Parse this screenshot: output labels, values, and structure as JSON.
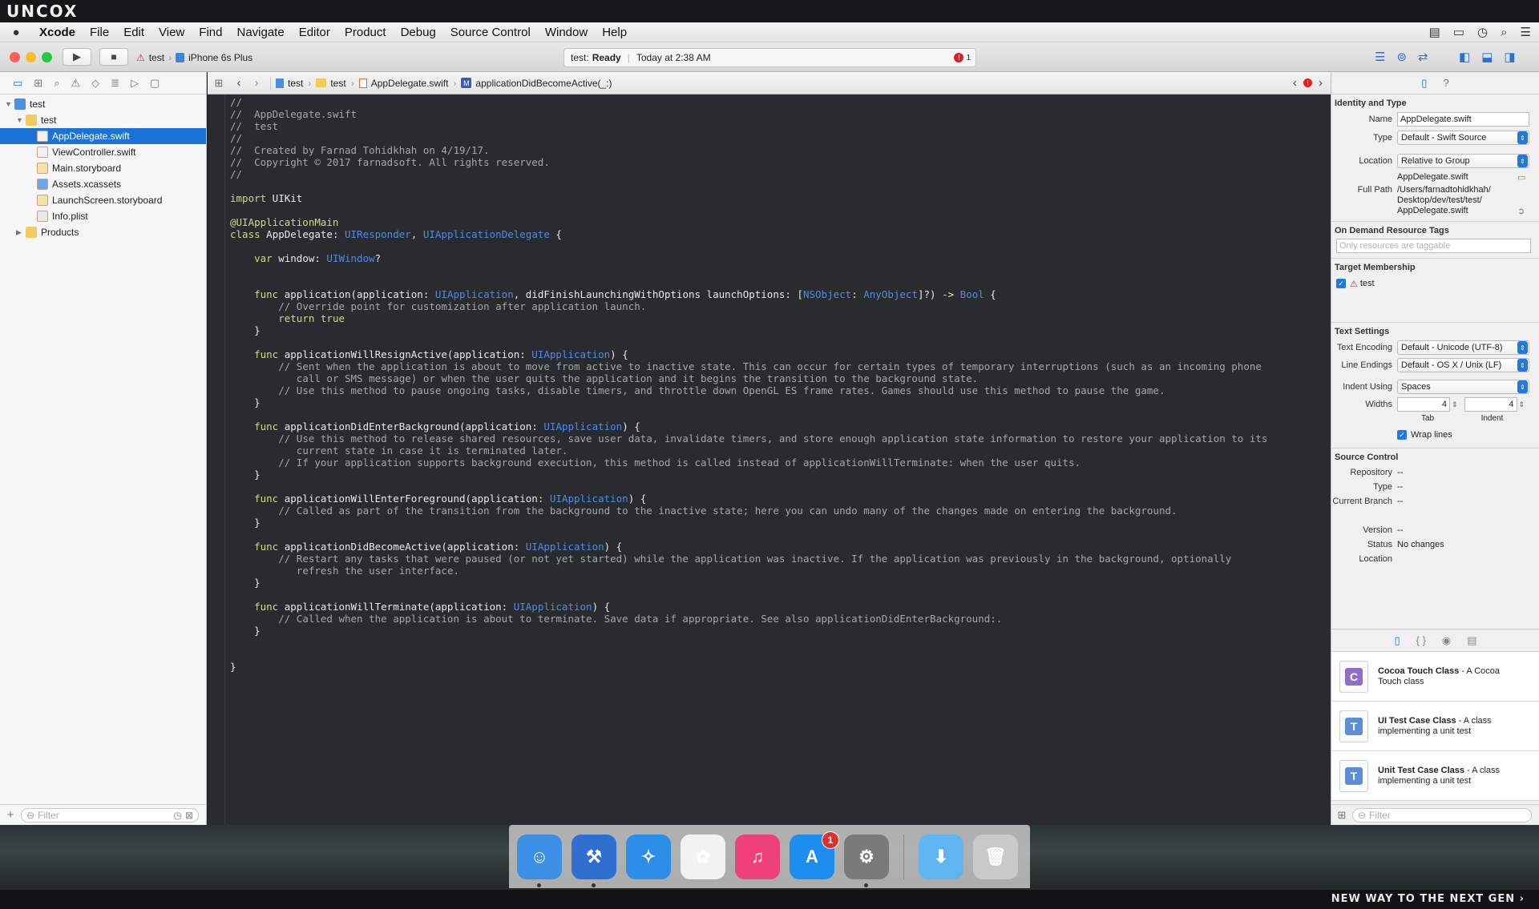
{
  "overlay": {
    "logo": "UNCOX",
    "slogan": "NEW WAY TO THE NEXT GEN ›"
  },
  "menubar": {
    "items": [
      "Xcode",
      "File",
      "Edit",
      "View",
      "Find",
      "Navigate",
      "Editor",
      "Product",
      "Debug",
      "Source Control",
      "Window",
      "Help"
    ]
  },
  "toolbar": {
    "scheme": "test",
    "device": "iPhone 6s Plus",
    "activity_project": "test:",
    "activity_status": "Ready",
    "activity_time": "Today at 2:38 AM",
    "issue_count": "1"
  },
  "navigator": {
    "project": "test",
    "group": "test",
    "files": [
      {
        "name": "AppDelegate.swift",
        "icon": "swift-file-icon",
        "selected": true
      },
      {
        "name": "ViewController.swift",
        "icon": "swift-file-icon"
      },
      {
        "name": "Main.storyboard",
        "icon": "storyboard-icon"
      },
      {
        "name": "Assets.xcassets",
        "icon": "asset-catalog-icon"
      },
      {
        "name": "LaunchScreen.storyboard",
        "icon": "storyboard-icon"
      },
      {
        "name": "Info.plist",
        "icon": "plist-icon"
      }
    ],
    "products": "Products",
    "filter_placeholder": "Filter"
  },
  "jumpbar": {
    "crumbs": [
      "test",
      "test",
      "AppDelegate.swift",
      "applicationDidBecomeActive(_:)"
    ]
  },
  "code_lines": [
    [
      [
        "c-cm",
        "//"
      ]
    ],
    [
      [
        "c-cm",
        "//  AppDelegate.swift"
      ]
    ],
    [
      [
        "c-cm",
        "//  test"
      ]
    ],
    [
      [
        "c-cm",
        "//"
      ]
    ],
    [
      [
        "c-cm",
        "//  Created by Farnad Tohidkhah on 4/19/17."
      ]
    ],
    [
      [
        "c-cm",
        "//  Copyright © 2017 farnadsoft. All rights reserved."
      ]
    ],
    [
      [
        "c-cm",
        "//"
      ]
    ],
    [],
    [
      [
        "c-kw",
        "import"
      ],
      [
        "",
        " UIKit"
      ]
    ],
    [],
    [
      [
        "c-at",
        "@UIApplicationMain"
      ]
    ],
    [
      [
        "c-kw",
        "class"
      ],
      [
        "",
        " AppDelegate: "
      ],
      [
        "c-ty",
        "UIResponder"
      ],
      [
        "",
        ", "
      ],
      [
        "c-ty",
        "UIApplicationDelegate"
      ],
      [
        "",
        " {"
      ]
    ],
    [],
    [
      [
        "",
        "    "
      ],
      [
        "c-kw",
        "var"
      ],
      [
        "",
        " window: "
      ],
      [
        "c-ty",
        "UIWindow"
      ],
      [
        "",
        "?"
      ]
    ],
    [],
    [],
    [
      [
        "",
        "    "
      ],
      [
        "c-kw",
        "func"
      ],
      [
        "",
        " application(application: "
      ],
      [
        "c-ty",
        "UIApplication"
      ],
      [
        "",
        ", didFinishLaunchingWithOptions launchOptions: ["
      ],
      [
        "c-ty",
        "NSObject"
      ],
      [
        "",
        ": "
      ],
      [
        "c-ty",
        "AnyObject"
      ],
      [
        "",
        "]?) -> "
      ],
      [
        "c-ty",
        "Bool"
      ],
      [
        "",
        " {"
      ]
    ],
    [
      [
        "",
        "        "
      ],
      [
        "c-cm",
        "// Override point for customization after application launch."
      ]
    ],
    [
      [
        "",
        "        "
      ],
      [
        "c-kw",
        "return"
      ],
      [
        "",
        " "
      ],
      [
        "c-kw",
        "true"
      ]
    ],
    [
      [
        "",
        "    }"
      ]
    ],
    [],
    [
      [
        "",
        "    "
      ],
      [
        "c-kw",
        "func"
      ],
      [
        "",
        " applicationWillResignActive(application: "
      ],
      [
        "c-ty",
        "UIApplication"
      ],
      [
        "",
        ") {"
      ]
    ],
    [
      [
        "",
        "        "
      ],
      [
        "c-cm",
        "// Sent when the application is about to move from active to inactive state. This can occur for certain types of temporary interruptions (such as an incoming phone"
      ]
    ],
    [
      [
        "",
        "           "
      ],
      [
        "c-cm",
        "call or SMS message) or when the user quits the application and it begins the transition to the background state."
      ]
    ],
    [
      [
        "",
        "        "
      ],
      [
        "c-cm",
        "// Use this method to pause ongoing tasks, disable timers, and throttle down OpenGL ES frame rates. Games should use this method to pause the game."
      ]
    ],
    [
      [
        "",
        "    }"
      ]
    ],
    [],
    [
      [
        "",
        "    "
      ],
      [
        "c-kw",
        "func"
      ],
      [
        "",
        " applicationDidEnterBackground(application: "
      ],
      [
        "c-ty",
        "UIApplication"
      ],
      [
        "",
        ") {"
      ]
    ],
    [
      [
        "",
        "        "
      ],
      [
        "c-cm",
        "// Use this method to release shared resources, save user data, invalidate timers, and store enough application state information to restore your application to its"
      ]
    ],
    [
      [
        "",
        "           "
      ],
      [
        "c-cm",
        "current state in case it is terminated later."
      ]
    ],
    [
      [
        "",
        "        "
      ],
      [
        "c-cm",
        "// If your application supports background execution, this method is called instead of applicationWillTerminate: when the user quits."
      ]
    ],
    [
      [
        "",
        "    }"
      ]
    ],
    [],
    [
      [
        "",
        "    "
      ],
      [
        "c-kw",
        "func"
      ],
      [
        "",
        " applicationWillEnterForeground(application: "
      ],
      [
        "c-ty",
        "UIApplication"
      ],
      [
        "",
        ") {"
      ]
    ],
    [
      [
        "",
        "        "
      ],
      [
        "c-cm",
        "// Called as part of the transition from the background to the inactive state; here you can undo many of the changes made on entering the background."
      ]
    ],
    [
      [
        "",
        "    }"
      ]
    ],
    [],
    [
      [
        "",
        "    "
      ],
      [
        "c-kw",
        "func"
      ],
      [
        "",
        " applicationDidBecomeActive(application: "
      ],
      [
        "c-ty",
        "UIApplication"
      ],
      [
        "",
        ") {"
      ]
    ],
    [
      [
        "",
        "        "
      ],
      [
        "c-cm",
        "// Restart any tasks that were paused (or not yet started) while the application was inactive. If the application was previously in the background, optionally"
      ]
    ],
    [
      [
        "",
        "           "
      ],
      [
        "c-cm",
        "refresh the user interface."
      ]
    ],
    [
      [
        "",
        "    }"
      ]
    ],
    [],
    [
      [
        "",
        "    "
      ],
      [
        "c-kw",
        "func"
      ],
      [
        "",
        " applicationWillTerminate(application: "
      ],
      [
        "c-ty",
        "UIApplication"
      ],
      [
        "",
        ") {"
      ]
    ],
    [
      [
        "",
        "        "
      ],
      [
        "c-cm",
        "// Called when the application is about to terminate. Save data if appropriate. See also applicationDidEnterBackground:."
      ]
    ],
    [
      [
        "",
        "    }"
      ]
    ],
    [],
    [],
    [
      [
        "",
        "}"
      ]
    ]
  ],
  "inspector": {
    "identity": {
      "title": "Identity and Type",
      "name_label": "Name",
      "name_value": "AppDelegate.swift",
      "type_label": "Type",
      "type_value": "Default - Swift Source",
      "location_label": "Location",
      "location_value": "Relative to Group",
      "location_file": "AppDelegate.swift",
      "fullpath_label": "Full Path",
      "fullpath_lines": [
        "/Users/farnadtohidkhah/",
        "Desktop/dev/test/test/",
        "AppDelegate.swift"
      ]
    },
    "tags": {
      "title": "On Demand Resource Tags",
      "placeholder": "Only resources are taggable"
    },
    "membership": {
      "title": "Target Membership",
      "target": "test"
    },
    "text_settings": {
      "title": "Text Settings",
      "encoding_label": "Text Encoding",
      "encoding_value": "Default - Unicode (UTF-8)",
      "endings_label": "Line Endings",
      "endings_value": "Default - OS X / Unix (LF)",
      "indent_label": "Indent Using",
      "indent_value": "Spaces",
      "widths_label": "Widths",
      "tab_value": "4",
      "indent_width_value": "4",
      "tab_caption": "Tab",
      "indent_caption": "Indent",
      "wrap_label": "Wrap lines"
    },
    "source_control": {
      "title": "Source Control",
      "rows": [
        {
          "k": "Repository",
          "v": "--"
        },
        {
          "k": "Type",
          "v": "--"
        },
        {
          "k": "Current Branch",
          "v": "--"
        },
        {
          "k": "",
          "v": ""
        },
        {
          "k": "Version",
          "v": "--"
        },
        {
          "k": "Status",
          "v": "No changes"
        },
        {
          "k": "Location",
          "v": ""
        }
      ]
    }
  },
  "library": {
    "items": [
      {
        "title": "Cocoa Touch Class",
        "desc": " - A Cocoa Touch class",
        "letter": "C",
        "color": "#8e6fc5"
      },
      {
        "title": "UI Test Case Class",
        "desc": " - A class implementing a unit test",
        "letter": "T",
        "color": "#5a8fd8"
      },
      {
        "title": "Unit Test Case Class",
        "desc": " - A class implementing a unit test",
        "letter": "T",
        "color": "#5a8fd8"
      }
    ],
    "filter_placeholder": "Filter"
  },
  "dock": {
    "apps": [
      {
        "name": "finder-icon",
        "color": "#3d8fe6",
        "glyph": "☺",
        "running": true
      },
      {
        "name": "xcode-icon",
        "color": "#2f6fd0",
        "glyph": "⚒",
        "running": true
      },
      {
        "name": "safari-icon",
        "color": "#2d8ee8",
        "glyph": "✧",
        "running": false
      },
      {
        "name": "photos-icon",
        "color": "#f2f2f2",
        "glyph": "✿",
        "running": false
      },
      {
        "name": "itunes-icon",
        "color": "#f0407a",
        "glyph": "♫",
        "running": false
      },
      {
        "name": "app-store-icon",
        "color": "#1c8ef0",
        "glyph": "A",
        "running": false,
        "badge": "1"
      },
      {
        "name": "system-preferences-icon",
        "color": "#7a7a7a",
        "glyph": "⚙",
        "running": true
      },
      {
        "name": "downloads-icon",
        "color": "#5fb5f0",
        "glyph": "⬇",
        "running": false
      },
      {
        "name": "trash-icon",
        "color": "#c9c9c9",
        "glyph": "🗑",
        "running": false
      }
    ]
  },
  "colors": {
    "accent": "#1a73d6",
    "editor_bg": "#292b2e",
    "error": "#e02020"
  }
}
